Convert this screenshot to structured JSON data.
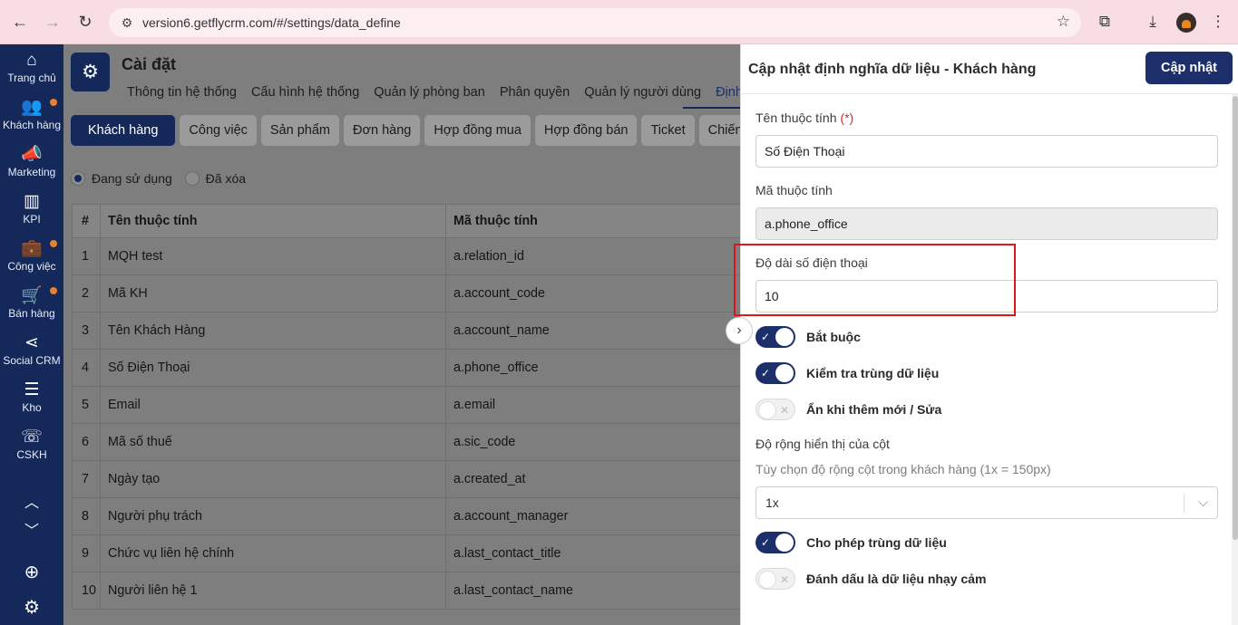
{
  "browser": {
    "url": "version6.getflycrm.com/#/settings/data_define"
  },
  "sidebar": {
    "items": [
      {
        "label": "Trang chủ",
        "icon": "home-icon",
        "glyph": "⌂",
        "dot": false
      },
      {
        "label": "Khách hàng",
        "icon": "users-icon",
        "glyph": "👥",
        "dot": true
      },
      {
        "label": "Marketing",
        "icon": "megaphone-icon",
        "glyph": "📣",
        "dot": false
      },
      {
        "label": "KPI",
        "icon": "bar-chart-icon",
        "glyph": "▥",
        "dot": false
      },
      {
        "label": "Công việc",
        "icon": "briefcase-icon",
        "glyph": "💼",
        "dot": true
      },
      {
        "label": "Bán hàng",
        "icon": "cart-icon",
        "glyph": "🛒",
        "dot": true
      },
      {
        "label": "Social CRM",
        "icon": "share-icon",
        "glyph": "⋖",
        "dot": false
      },
      {
        "label": "Kho",
        "icon": "warehouse-icon",
        "glyph": "☰",
        "dot": false
      },
      {
        "label": "CSKH",
        "icon": "phone-icon",
        "glyph": "☏",
        "dot": false
      }
    ]
  },
  "header": {
    "title": "Cài đặt",
    "tabs": [
      "Thông tin hệ thống",
      "Cấu hình hệ thống",
      "Quản lý phòng ban",
      "Phân quyền",
      "Quản lý người dùng",
      "Định nghĩ"
    ]
  },
  "entity_tabs": [
    "Khách hàng",
    "Công việc",
    "Sản phẩm",
    "Đơn hàng",
    "Hợp đồng mua",
    "Hợp đồng bán",
    "Ticket",
    "Chiến"
  ],
  "filter": {
    "in_use": "Đang sử dụng",
    "deleted": "Đã xóa"
  },
  "table": {
    "headers": [
      "#",
      "Tên thuộc tính",
      "Mã thuộc tính"
    ],
    "rows": [
      [
        "1",
        "MQH test",
        "a.relation_id"
      ],
      [
        "2",
        "Mã KH",
        "a.account_code"
      ],
      [
        "3",
        "Tên Khách Hàng",
        "a.account_name"
      ],
      [
        "4",
        "Số Điện Thoại",
        "a.phone_office"
      ],
      [
        "5",
        "Email",
        "a.email"
      ],
      [
        "6",
        "Mã số thuế",
        "a.sic_code"
      ],
      [
        "7",
        "Ngày tạo",
        "a.created_at"
      ],
      [
        "8",
        "Người phụ trách",
        "a.account_manager"
      ],
      [
        "9",
        "Chức vụ liên hệ chính",
        "a.last_contact_title"
      ],
      [
        "10",
        "Người liên hệ 1",
        "a.last_contact_name"
      ]
    ]
  },
  "panel": {
    "title": "Cập nhật định nghĩa dữ liệu - Khách hàng",
    "update_label": "Cập nhật",
    "name_label": "Tên thuộc tính",
    "required_mark": "(*)",
    "name_value": "Số Điện Thoại",
    "code_label": "Mã thuộc tính",
    "code_value": "a.phone_office",
    "length_label": "Độ dài số điện thoại",
    "length_value": "10",
    "toggles": [
      {
        "label": "Bắt buộc",
        "on": true
      },
      {
        "label": "Kiểm tra trùng dữ liệu",
        "on": true
      },
      {
        "label": "Ẩn khi thêm mới / Sửa",
        "on": false
      }
    ],
    "width_label": "Độ rộng hiển thị của cột",
    "width_hint": "Tùy chọn độ rộng cột trong khách hàng (1x = 150px)",
    "width_value": "1x",
    "toggles2": [
      {
        "label": "Cho phép trùng dữ liệu",
        "on": true
      },
      {
        "label": "Đánh dấu là dữ liệu nhạy cảm",
        "on": false
      }
    ]
  }
}
